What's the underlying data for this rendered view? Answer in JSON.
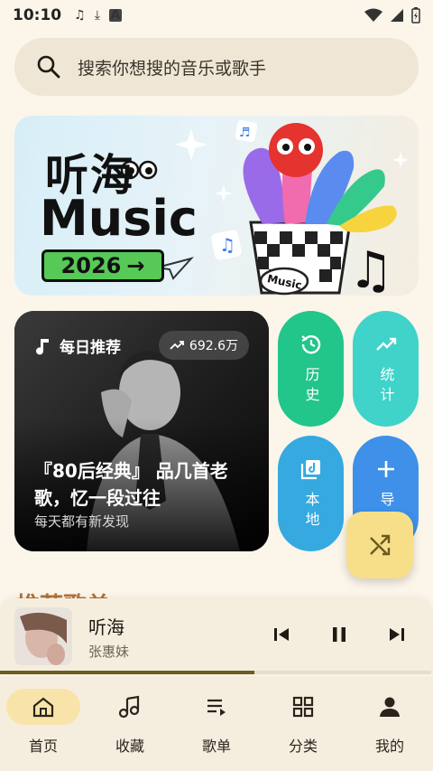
{
  "status_bar": {
    "time": "10:10"
  },
  "search": {
    "placeholder": "搜索你想搜的音乐或歌手"
  },
  "banner": {
    "title_line1": "听海",
    "title_line2": "Music",
    "badge": "2026",
    "cup_label": "Music"
  },
  "daily": {
    "label": "每日推荐",
    "count": "692.6万",
    "title": "『80后经典』 品几首老歌，忆一段过往",
    "subtitle": "每天都有新发现"
  },
  "tiles": [
    {
      "label": "历史",
      "icon": "history-icon",
      "color": "#22C58A"
    },
    {
      "label": "统计",
      "icon": "trending-icon",
      "color": "#3FD3C9"
    },
    {
      "label": "本地",
      "icon": "music-library-icon",
      "color": "#35A9E0"
    },
    {
      "label": "导入",
      "icon": "plus-icon",
      "color": "#3E90E8"
    }
  ],
  "section": {
    "title": "推荐歌单"
  },
  "player": {
    "title": "听海",
    "artist": "张惠妹",
    "progress": 0.59
  },
  "nav": [
    {
      "label": "首页",
      "icon": "home-icon",
      "active": true
    },
    {
      "label": "收藏",
      "icon": "favorite-music-icon",
      "active": false
    },
    {
      "label": "歌单",
      "icon": "playlist-icon",
      "active": false
    },
    {
      "label": "分类",
      "icon": "category-grid-icon",
      "active": false
    },
    {
      "label": "我的",
      "icon": "profile-icon",
      "active": false
    }
  ]
}
